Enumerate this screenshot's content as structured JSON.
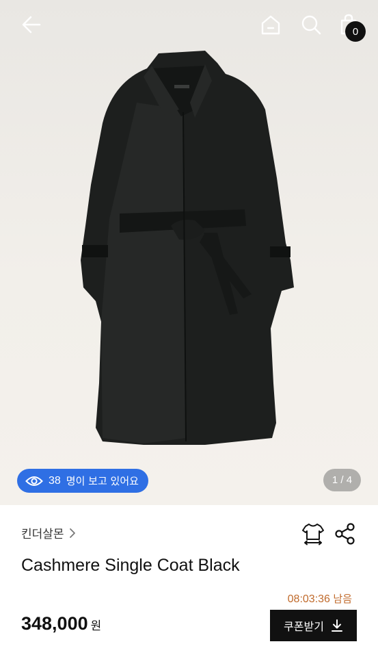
{
  "cart": {
    "count": "0"
  },
  "viewers": {
    "count": "38",
    "text": "명이 보고 있어요"
  },
  "gallery": {
    "page_indicator": "1 / 4"
  },
  "product": {
    "brand": "킨더살몬",
    "name": "Cashmere Single Coat Black",
    "price": "348,000",
    "currency": "원"
  },
  "timer": {
    "time": "08:03:36",
    "suffix": "남음"
  },
  "coupon": {
    "label": "쿠폰받기"
  },
  "icons": {
    "back": "arrow-left-icon",
    "home": "home-icon",
    "search": "search-icon",
    "cart": "shopping-bag-icon",
    "eye": "eye-icon",
    "fit": "size-fit-icon",
    "share": "share-icon",
    "download": "download-icon",
    "brand_chevron": "chevron-right-icon"
  },
  "colors": {
    "accent": "#2f6fe4",
    "timer": "#c06a2b",
    "dark": "#111111"
  }
}
